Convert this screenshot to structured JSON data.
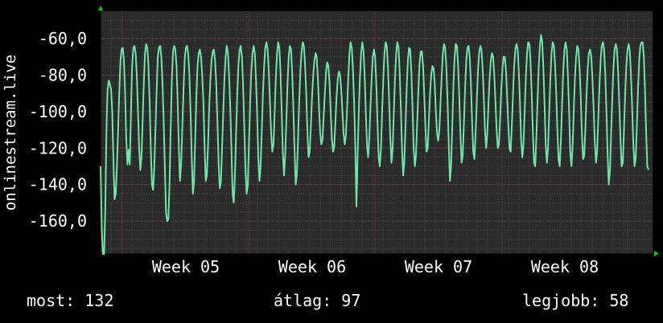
{
  "chart_data": {
    "type": "line",
    "ylabel": "onlinestream.live",
    "yticks": [
      "-60,0",
      "-80,0",
      "-100,0",
      "-120,0",
      "-140,0",
      "-160,0"
    ],
    "ytick_values": [
      -60,
      -80,
      -100,
      -120,
      -140,
      -160
    ],
    "xticks": [
      "Week 05",
      "Week 06",
      "Week 07",
      "Week 08"
    ],
    "ylim": [
      -178,
      -45
    ],
    "grid": true,
    "colors": {
      "background": "#000000",
      "plot_background": "#2b2b2b",
      "grid_minor": "#4a4a4a",
      "grid_major": "#7a3a3a",
      "series": "#6ee6a8",
      "axis_arrow": "#00cc00"
    },
    "series": [
      {
        "values": [
          -130,
          -165,
          -178,
          -178,
          -155,
          -110,
          -88,
          -83,
          -85,
          -88,
          -100,
          -128,
          -148,
          -145,
          -130,
          -110,
          -90,
          -72,
          -66,
          -65,
          -72,
          -90,
          -115,
          -129,
          -121,
          -129,
          -100,
          -75,
          -65,
          -64,
          -68,
          -80,
          -100,
          -120,
          -132,
          -125,
          -105,
          -85,
          -68,
          -63,
          -65,
          -75,
          -95,
          -120,
          -140,
          -143,
          -130,
          -110,
          -88,
          -70,
          -65,
          -64,
          -70,
          -85,
          -105,
          -130,
          -155,
          -160,
          -159,
          -140,
          -110,
          -82,
          -67,
          -64,
          -66,
          -75,
          -95,
          -120,
          -138,
          -128,
          -108,
          -88,
          -72,
          -65,
          -64,
          -68,
          -80,
          -100,
          -125,
          -145,
          -138,
          -115,
          -92,
          -75,
          -68,
          -66,
          -70,
          -80,
          -95,
          -118,
          -138,
          -135,
          -118,
          -98,
          -82,
          -72,
          -67,
          -66,
          -72,
          -85,
          -105,
          -128,
          -142,
          -138,
          -120,
          -100,
          -82,
          -70,
          -64,
          -68,
          -80,
          -98,
          -120,
          -145,
          -150,
          -135,
          -112,
          -90,
          -75,
          -66,
          -64,
          -70,
          -85,
          -108,
          -132,
          -145,
          -140,
          -118,
          -95,
          -78,
          -68,
          -64,
          -68,
          -82,
          -102,
          -125,
          -138,
          -130,
          -110,
          -90,
          -75,
          -65,
          -62,
          -66,
          -78,
          -95,
          -112,
          -122,
          -118,
          -100,
          -82,
          -68,
          -62,
          -65,
          -78,
          -100,
          -122,
          -135,
          -125,
          -105,
          -85,
          -70,
          -64,
          -66,
          -78,
          -98,
          -120,
          -140,
          -135,
          -115,
          -95,
          -78,
          -68,
          -62,
          -64,
          -74,
          -90,
          -110,
          -125,
          -122,
          -108,
          -92,
          -80,
          -72,
          -68,
          -70,
          -82,
          -98,
          -112,
          -118,
          -115,
          -102,
          -90,
          -78,
          -73,
          -75,
          -85,
          -100,
          -115,
          -122,
          -119,
          -105,
          -92,
          -82,
          -78,
          -80,
          -88,
          -100,
          -112,
          -118,
          -113,
          -98,
          -82,
          -68,
          -62,
          -65,
          -76,
          -95,
          -118,
          -152,
          -125,
          -100,
          -82,
          -68,
          -62,
          -66,
          -80,
          -100,
          -118,
          -125,
          -115,
          -98,
          -82,
          -70,
          -66,
          -70,
          -85,
          -105,
          -125,
          -130,
          -120,
          -100,
          -82,
          -68,
          -62,
          -64,
          -76,
          -95,
          -115,
          -128,
          -120,
          -100,
          -82,
          -68,
          -62,
          -65,
          -78,
          -98,
          -120,
          -135,
          -128,
          -108,
          -88,
          -72,
          -65,
          -66,
          -78,
          -98,
          -120,
          -130,
          -124,
          -106,
          -88,
          -74,
          -67,
          -67,
          -75,
          -90,
          -108,
          -122,
          -120,
          -105,
          -90,
          -80,
          -75,
          -76,
          -85,
          -100,
          -112,
          -116,
          -110,
          -95,
          -80,
          -68,
          -63,
          -65,
          -76,
          -95,
          -118,
          -138,
          -130,
          -108,
          -86,
          -70,
          -63,
          -64,
          -74,
          -92,
          -112,
          -128,
          -124,
          -106,
          -88,
          -72,
          -65,
          -64,
          -70,
          -85,
          -105,
          -122,
          -126,
          -112,
          -94,
          -78,
          -68,
          -64,
          -66,
          -76,
          -92,
          -110,
          -120,
          -112,
          -96,
          -82,
          -72,
          -68,
          -70,
          -80,
          -95,
          -110,
          -120,
          -118,
          -104,
          -88,
          -76,
          -70,
          -70,
          -78,
          -92,
          -108,
          -120,
          -122,
          -108,
          -90,
          -75,
          -66,
          -63,
          -66,
          -78,
          -96,
          -116,
          -125,
          -118,
          -100,
          -82,
          -68,
          -62,
          -63,
          -72,
          -90,
          -110,
          -128,
          -130,
          -114,
          -94,
          -76,
          -64,
          -58,
          -62,
          -76,
          -96,
          -118,
          -128,
          -120,
          -100,
          -82,
          -68,
          -62,
          -64,
          -74,
          -90,
          -110,
          -126,
          -130,
          -116,
          -96,
          -78,
          -66,
          -62,
          -66,
          -80,
          -100,
          -122,
          -130,
          -120,
          -100,
          -82,
          -70,
          -64,
          -66,
          -76,
          -92,
          -112,
          -126,
          -124,
          -108,
          -90,
          -76,
          -68,
          -66,
          -70,
          -82,
          -98,
          -116,
          -128,
          -122,
          -104,
          -86,
          -72,
          -64,
          -62,
          -66,
          -80,
          -100,
          -124,
          -140,
          -132,
          -112,
          -92,
          -76,
          -66,
          -63,
          -66,
          -78,
          -96,
          -116,
          -130,
          -128,
          -110,
          -90,
          -75,
          -66,
          -63,
          -67,
          -80,
          -98,
          -118,
          -130,
          -126,
          -108,
          -88,
          -72,
          -64,
          -62,
          -62,
          -70,
          -88,
          -112,
          -130,
          -132
        ]
      }
    ]
  },
  "stats": {
    "current": "most: 132",
    "average": "átlag: 97",
    "best": "legjobb: 58"
  }
}
